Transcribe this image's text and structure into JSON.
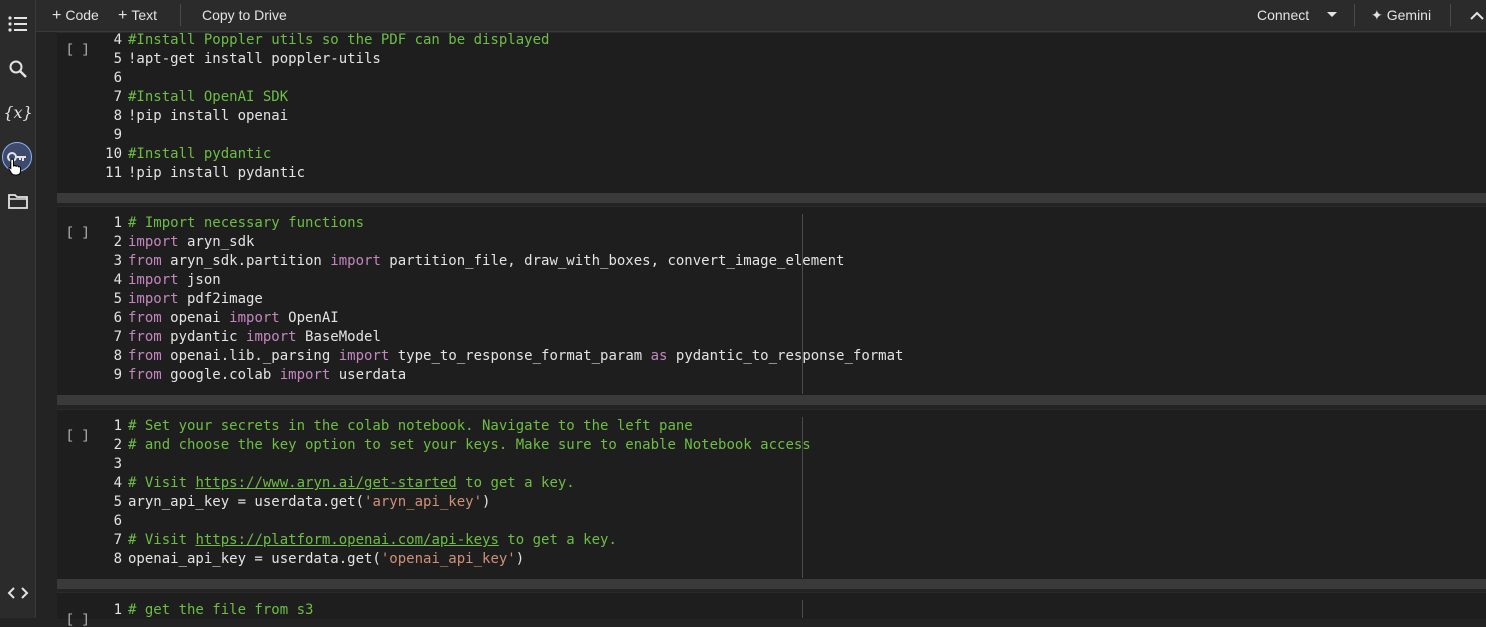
{
  "toolbar": {
    "add_code_label": "Code",
    "add_text_label": "Text",
    "copy_to_drive_label": "Copy to Drive",
    "connect_label": "Connect",
    "gemini_label": "Gemini"
  },
  "sidebar": {
    "icons": [
      "table-of-contents-icon",
      "search-icon",
      "variables-icon",
      "secrets-key-icon",
      "files-folder-icon",
      "code-snippets-icon"
    ],
    "variables_glyph": "{x}"
  },
  "cells": [
    {
      "run_label": "[ ]",
      "lines": [
        {
          "n": "4",
          "t": "#Install Poppler utils so the PDF can be displayed"
        },
        {
          "n": "5",
          "t": "!apt-get install poppler-utils"
        },
        {
          "n": "6",
          "t": ""
        },
        {
          "n": "7",
          "t": "#Install OpenAI SDK"
        },
        {
          "n": "8",
          "t": "!pip install openai"
        },
        {
          "n": "9",
          "t": ""
        },
        {
          "n": "10",
          "t": "#Install pydantic"
        },
        {
          "n": "11",
          "t": "!pip install pydantic"
        }
      ]
    },
    {
      "run_label": "[ ]",
      "lines": [
        {
          "n": "1",
          "t": "# Import necessary functions"
        },
        {
          "n": "2",
          "t": "import aryn_sdk"
        },
        {
          "n": "3",
          "t": "from aryn_sdk.partition import partition_file, draw_with_boxes, convert_image_element"
        },
        {
          "n": "4",
          "t": "import json"
        },
        {
          "n": "5",
          "t": "import pdf2image"
        },
        {
          "n": "6",
          "t": "from openai import OpenAI"
        },
        {
          "n": "7",
          "t": "from pydantic import BaseModel"
        },
        {
          "n": "8",
          "t": "from openai.lib._parsing import type_to_response_format_param as pydantic_to_response_format"
        },
        {
          "n": "9",
          "t": "from google.colab import userdata"
        }
      ]
    },
    {
      "run_label": "[ ]",
      "lines": [
        {
          "n": "1",
          "t": "# Set your secrets in the colab notebook. Navigate to the left pane"
        },
        {
          "n": "2",
          "t": "# and choose the key option to set your keys. Make sure to enable Notebook access"
        },
        {
          "n": "3",
          "t": ""
        },
        {
          "n": "4",
          "t": "# Visit https://www.aryn.ai/get-started to get a key."
        },
        {
          "n": "5",
          "t": "aryn_api_key = userdata.get('aryn_api_key')"
        },
        {
          "n": "6",
          "t": ""
        },
        {
          "n": "7",
          "t": "# Visit https://platform.openai.com/api-keys to get a key."
        },
        {
          "n": "8",
          "t": "openai_api_key = userdata.get('openai_api_key')"
        }
      ]
    },
    {
      "run_label": "[ ]",
      "lines": [
        {
          "n": "1",
          "t": "# get the file from s3"
        }
      ]
    }
  ],
  "colors": {
    "comment": "#6cbe45",
    "keyword": "#c586c0",
    "string": "#ce9178",
    "accent": "#8ab4f8"
  }
}
